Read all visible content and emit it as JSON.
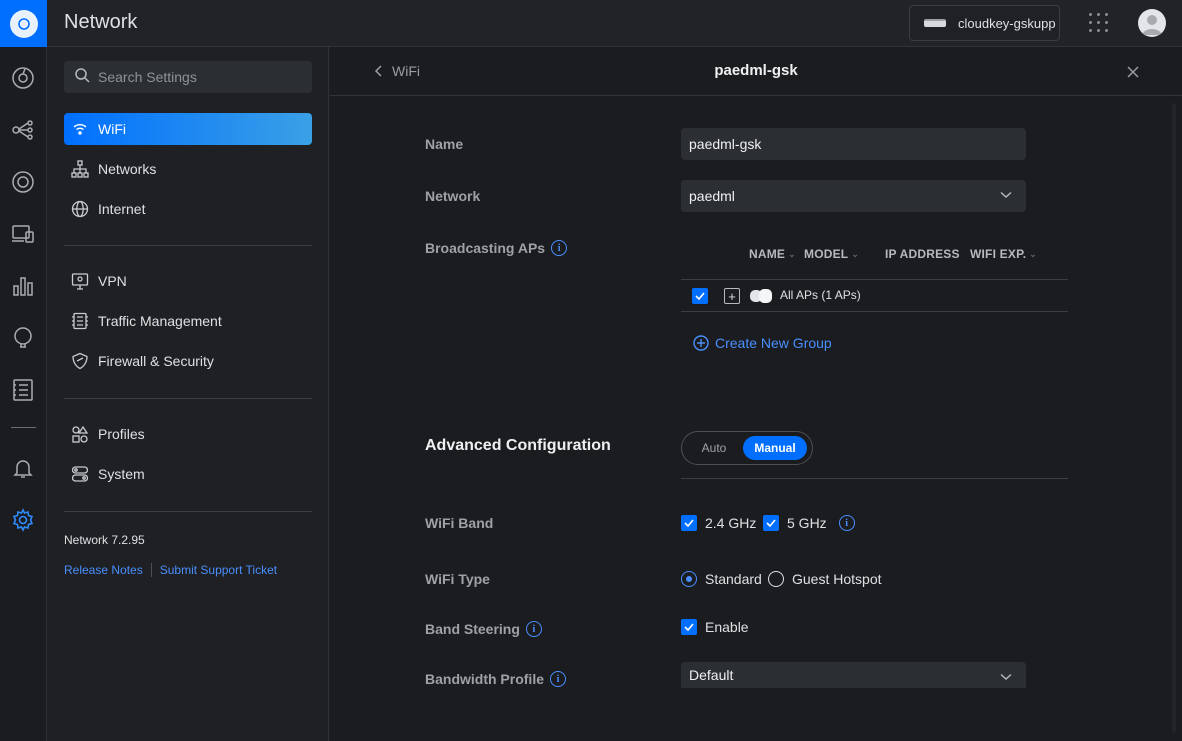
{
  "app": {
    "title": "Network"
  },
  "topbar": {
    "device_name": "cloudkey-gskupp"
  },
  "rail": {
    "icons": [
      "dashboard-icon",
      "topology-icon",
      "devices-icon",
      "clients-icon",
      "statistics-icon",
      "insights-icon",
      "logs-icon",
      "notifications-icon",
      "settings-icon"
    ]
  },
  "sidebar": {
    "search_placeholder": "Search Settings",
    "items": [
      {
        "label": "WiFi",
        "icon": "wifi-icon",
        "active": true
      },
      {
        "label": "Networks",
        "icon": "network-tree-icon"
      },
      {
        "label": "Internet",
        "icon": "globe-icon"
      },
      {
        "label": "VPN",
        "icon": "vpn-icon"
      },
      {
        "label": "Traffic Management",
        "icon": "traffic-icon"
      },
      {
        "label": "Firewall & Security",
        "icon": "shield-icon"
      },
      {
        "label": "Profiles",
        "icon": "profiles-icon"
      },
      {
        "label": "System",
        "icon": "system-icon"
      }
    ],
    "version": "Network 7.2.95",
    "links": {
      "release_notes": "Release Notes",
      "support": "Submit Support Ticket"
    }
  },
  "panel": {
    "back_label": "WiFi",
    "title": "paedml-gsk",
    "name": {
      "label": "Name",
      "value": "paedml-gsk"
    },
    "network": {
      "label": "Network",
      "value": "paedml"
    },
    "broadcasting": {
      "label": "Broadcasting APs",
      "columns": [
        "NAME",
        "MODEL",
        "IP ADDRESS",
        "WIFI EXP."
      ],
      "row_label": "All APs (1 APs)",
      "create_group": "Create New Group"
    },
    "advanced": {
      "title": "Advanced Configuration",
      "auto": "Auto",
      "manual": "Manual",
      "selected": "Manual"
    },
    "wifi_band": {
      "label": "WiFi Band",
      "band_24": "2.4 GHz",
      "band_5": "5 GHz"
    },
    "wifi_type": {
      "label": "WiFi Type",
      "standard": "Standard",
      "guest": "Guest Hotspot",
      "selected": "Standard"
    },
    "band_steering": {
      "label": "Band Steering",
      "enable": "Enable"
    },
    "bandwidth_profile": {
      "label": "Bandwidth Profile",
      "value": "Default"
    }
  },
  "colors": {
    "accent": "#006fff",
    "link": "#4a8fff",
    "background": "#1a1c1f"
  }
}
